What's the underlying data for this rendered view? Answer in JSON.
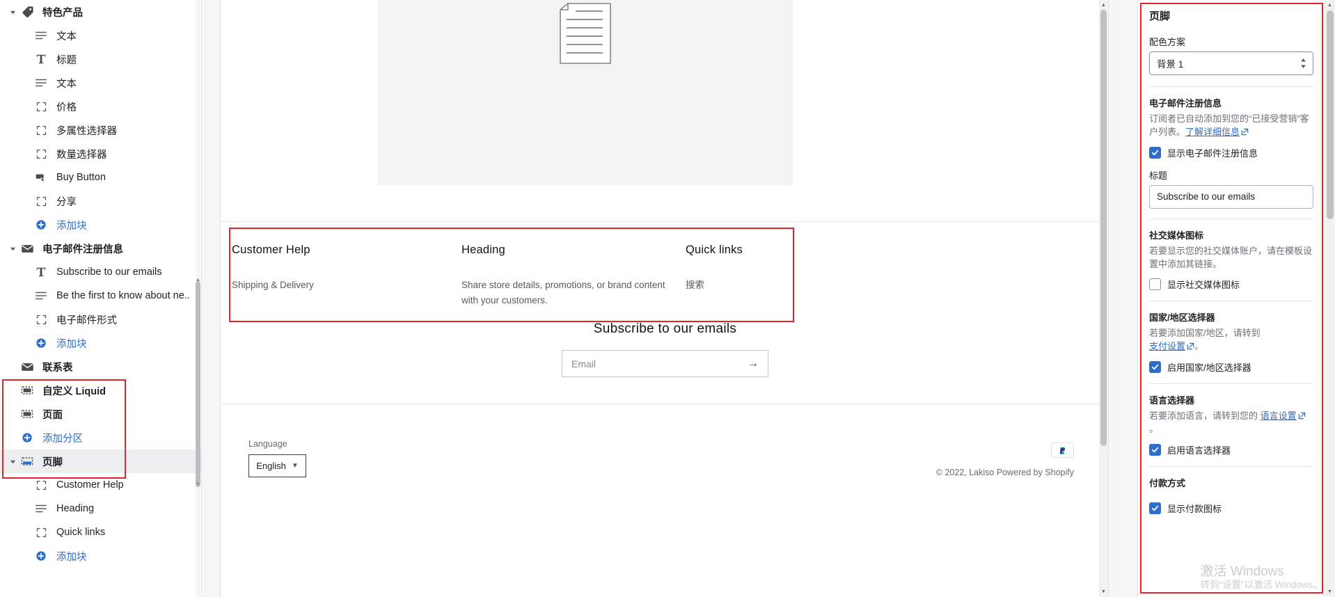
{
  "sidebar": {
    "items": [
      {
        "label": "特色产品",
        "icon": "tag-icon",
        "level": "section",
        "caret": true,
        "selected": false
      },
      {
        "label": "文本",
        "icon": "text-lines-icon",
        "level": "block"
      },
      {
        "label": "标题",
        "icon": "heading-t-icon",
        "level": "block"
      },
      {
        "label": "文本",
        "icon": "text-lines-icon",
        "level": "block"
      },
      {
        "label": "价格",
        "icon": "placeholder-brackets-icon",
        "level": "block"
      },
      {
        "label": "多属性选择器",
        "icon": "placeholder-brackets-icon",
        "level": "block"
      },
      {
        "label": "数量选择器",
        "icon": "placeholder-brackets-icon",
        "level": "block"
      },
      {
        "label": "Buy Button",
        "icon": "buy-button-icon",
        "level": "block"
      },
      {
        "label": "分享",
        "icon": "placeholder-brackets-icon",
        "level": "block"
      },
      {
        "label": "添加块",
        "icon": "plus-circle-icon",
        "level": "add-block"
      },
      {
        "label": "电子邮件注册信息",
        "icon": "envelope-icon",
        "level": "section",
        "caret": true
      },
      {
        "label": "Subscribe to our emails",
        "icon": "heading-t-icon",
        "level": "block"
      },
      {
        "label": "Be the first to know about ne..",
        "icon": "text-lines-icon",
        "level": "block"
      },
      {
        "label": "电子邮件形式",
        "icon": "placeholder-brackets-icon",
        "level": "block"
      },
      {
        "label": "添加块",
        "icon": "plus-circle-icon",
        "level": "add-block"
      },
      {
        "label": "联系表",
        "icon": "envelope-icon",
        "level": "section",
        "caret": false
      },
      {
        "label": "自定义 Liquid",
        "icon": "dashed-box-icon",
        "level": "section",
        "caret": false
      },
      {
        "label": "页面",
        "icon": "dashed-box-icon",
        "level": "section",
        "caret": false
      },
      {
        "label": "添加分区",
        "icon": "plus-circle-icon",
        "level": "add-section"
      },
      {
        "label": "页脚",
        "icon": "footer-icon",
        "level": "section",
        "caret": true,
        "selected": true
      },
      {
        "label": "Customer Help",
        "icon": "placeholder-brackets-icon",
        "level": "block"
      },
      {
        "label": "Heading",
        "icon": "text-lines-icon",
        "level": "block"
      },
      {
        "label": "Quick links",
        "icon": "placeholder-brackets-icon",
        "level": "block"
      },
      {
        "label": "添加块",
        "icon": "plus-circle-icon",
        "level": "add-block"
      }
    ]
  },
  "preview": {
    "columns": [
      {
        "heading": "Customer Help",
        "body": "Shipping & Delivery"
      },
      {
        "heading": "Heading",
        "body": "Share store details, promotions, or brand content with your customers."
      },
      {
        "heading": "Quick links",
        "body": "搜索"
      }
    ],
    "subscribe": {
      "title": "Subscribe to our emails",
      "email_placeholder": "Email",
      "submit_icon": "arrow-right-icon"
    },
    "language_label": "Language",
    "language_value": "English",
    "payment_icon": "paypal-icon",
    "copyright": "© 2022, Lakiso Powered by Shopify"
  },
  "right_panel": {
    "title": "页脚",
    "color_scheme": {
      "label": "配色方案",
      "value": "背景 1"
    },
    "email_signup": {
      "heading": "电子邮件注册信息",
      "help_prefix": "订阅者已自动添加到您的“已接受营销”客户列表。",
      "help_link": "了解详细信息",
      "checkbox_label": "显示电子邮件注册信息",
      "checkbox_checked": true,
      "title_label": "标题",
      "title_value": "Subscribe to our emails"
    },
    "social_icons": {
      "heading": "社交媒体图标",
      "help": "若要显示您的社交媒体账户，请在模板设置中添加其链接。",
      "checkbox_label": "显示社交媒体图标",
      "checkbox_checked": false
    },
    "country_selector": {
      "heading": "国家/地区选择器",
      "help_prefix": "若要添加国家/地区，请转到",
      "help_link": "支付设置",
      "help_suffix": "。",
      "checkbox_label": "启用国家/地区选择器",
      "checkbox_checked": true
    },
    "language_selector": {
      "heading": "语言选择器",
      "help_prefix": "若要添加语言，请转到您的",
      "help_link": "语言设置",
      "help_suffix": "。",
      "checkbox_label": "启用语言选择器",
      "checkbox_checked": true
    },
    "payment_methods": {
      "heading": "付款方式",
      "checkbox_label": "显示付款图标",
      "checkbox_checked": true
    }
  },
  "watermark": {
    "line1": "激活 Windows",
    "line2": "转到“设置”以激活 Windows。"
  },
  "colors": {
    "accent": "#2c6ecb",
    "highlight": "#e8232a",
    "selected_row": "#edeeef",
    "text": "#202223",
    "muted": "#6d7175"
  }
}
